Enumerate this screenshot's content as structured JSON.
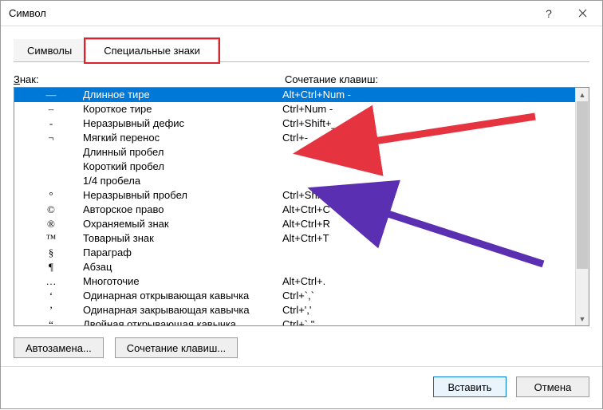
{
  "window": {
    "title": "Символ"
  },
  "tabs": {
    "symbols": "Символы",
    "special": "Специальные знаки"
  },
  "headers": {
    "sign_pre": "",
    "sign_accel": "З",
    "sign_post": "нак:",
    "shortcut": "Сочетание клавиш:"
  },
  "rows": [
    {
      "sym": "—",
      "name": "Длинное тире",
      "short": "Alt+Ctrl+Num -"
    },
    {
      "sym": "–",
      "name": "Короткое тире",
      "short": "Ctrl+Num -"
    },
    {
      "sym": "-",
      "name": "Неразрывный дефис",
      "short": "Ctrl+Shift+_"
    },
    {
      "sym": "¬",
      "name": "Мягкий перенос",
      "short": "Ctrl+-"
    },
    {
      "sym": "",
      "name": "Длинный пробел",
      "short": ""
    },
    {
      "sym": "",
      "name": "Короткий пробел",
      "short": ""
    },
    {
      "sym": "",
      "name": "1/4 пробела",
      "short": ""
    },
    {
      "sym": "°",
      "name": "Неразрывный пробел",
      "short": "Ctrl+Shift+Пробел"
    },
    {
      "sym": "©",
      "name": "Авторское право",
      "short": "Alt+Ctrl+C"
    },
    {
      "sym": "®",
      "name": "Охраняемый знак",
      "short": "Alt+Ctrl+R"
    },
    {
      "sym": "™",
      "name": "Товарный знак",
      "short": "Alt+Ctrl+T"
    },
    {
      "sym": "§",
      "name": "Параграф",
      "short": ""
    },
    {
      "sym": "¶",
      "name": "Абзац",
      "short": ""
    },
    {
      "sym": "…",
      "name": "Многоточие",
      "short": "Alt+Ctrl+."
    },
    {
      "sym": "‘",
      "name": "Одинарная открывающая кавычка",
      "short": "Ctrl+`,`"
    },
    {
      "sym": "’",
      "name": "Одинарная закрывающая кавычка",
      "short": "Ctrl+','"
    },
    {
      "sym": "“",
      "name": "Двойная открывающая кавычка",
      "short": "Ctrl+`,\""
    }
  ],
  "buttons": {
    "autocorrect": "Автозамена...",
    "shortcut": "Сочетание клавиш...",
    "insert": "Вставить",
    "cancel": "Отмена"
  },
  "selected_index": 0,
  "annotations": {
    "tab_highlight_color": "#d9242e",
    "arrow1_color": "#e53340",
    "arrow2_color": "#5a2fb1"
  }
}
